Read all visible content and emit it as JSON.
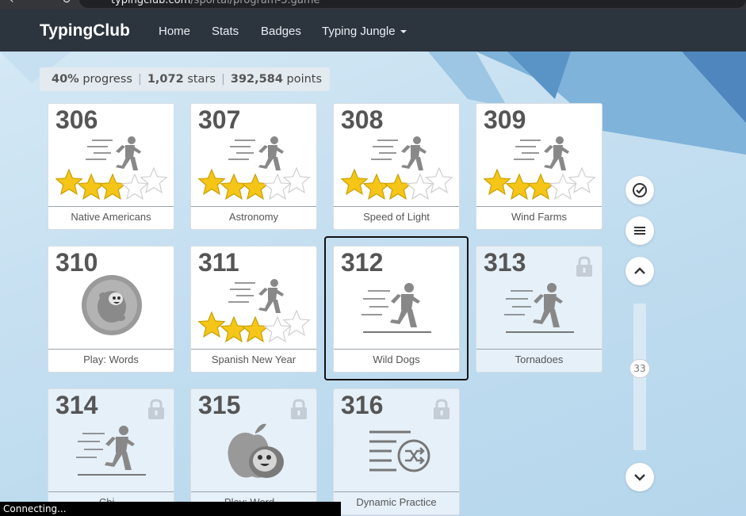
{
  "browser": {
    "url_host": "typingclub.com",
    "url_path": "/sportal/program-3.game"
  },
  "nav": {
    "brand": "TypingClub",
    "links": [
      "Home",
      "Stats",
      "Badges",
      "Typing Jungle"
    ]
  },
  "stats": {
    "progress_value": "40%",
    "progress_label": "progress",
    "stars_value": "1,072",
    "stars_label": "stars",
    "points_value": "392,584",
    "points_label": "points"
  },
  "lessons": [
    {
      "num": "306",
      "title": "Native Americans",
      "stars": 3,
      "icon": "runner-icon",
      "locked": false
    },
    {
      "num": "307",
      "title": "Astronomy",
      "stars": 3,
      "icon": "runner-icon",
      "locked": false
    },
    {
      "num": "308",
      "title": "Speed of Light",
      "stars": 3,
      "icon": "runner-icon",
      "locked": false
    },
    {
      "num": "309",
      "title": "Wind Farms",
      "stars": 3,
      "icon": "runner-icon",
      "locked": false
    },
    {
      "num": "310",
      "title": "Play: Words",
      "stars": 0,
      "icon": "game-bubble-icon",
      "locked": false
    },
    {
      "num": "311",
      "title": "Spanish New Year",
      "stars": 3,
      "icon": "runner-icon",
      "locked": false
    },
    {
      "num": "312",
      "title": "Wild Dogs",
      "stars": 0,
      "icon": "runner-icon",
      "locked": false,
      "selected": true
    },
    {
      "num": "313",
      "title": "Tornadoes",
      "stars": 0,
      "icon": "runner-icon",
      "locked": true
    },
    {
      "num": "314",
      "title": "Chi...",
      "stars": 0,
      "icon": "runner-icon",
      "locked": true
    },
    {
      "num": "315",
      "title": "Play: Word...",
      "stars": 0,
      "icon": "apple-game-icon",
      "locked": true
    },
    {
      "num": "316",
      "title": "Dynamic Practice",
      "stars": 0,
      "icon": "shuffle-icon",
      "locked": true
    }
  ],
  "sidebar": {
    "scroll_label": "33"
  },
  "status_text": "Connecting...",
  "colors": {
    "navbar": "#2c343e",
    "star": "#f5c518",
    "locked_card": "#e6f0f9"
  }
}
